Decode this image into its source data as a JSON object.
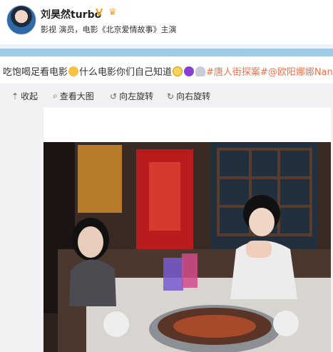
{
  "header": {
    "username": "刘昊然turbo",
    "verified_badge": "V",
    "bio": "影视 演员，电影《北京爱情故事》主演"
  },
  "post": {
    "text_main": "吃饱喝足看电影",
    "text_mid": "什么电影你们自己知道",
    "hashtag": "#唐人街探案#",
    "mention": "@欧阳娜娜Nana"
  },
  "toolbar": {
    "collapse": "收起",
    "view_large": "查看大图",
    "rotate_left": "向左旋转",
    "rotate_right": "向右旋转"
  },
  "icons": [
    "avatar",
    "verified-badge",
    "crown-icon",
    "smile-emoji",
    "grin-emoji",
    "devil-emoji",
    "ghost-emoji",
    "collapse-icon",
    "zoom-icon",
    "rotate-left-icon",
    "rotate-right-icon"
  ]
}
